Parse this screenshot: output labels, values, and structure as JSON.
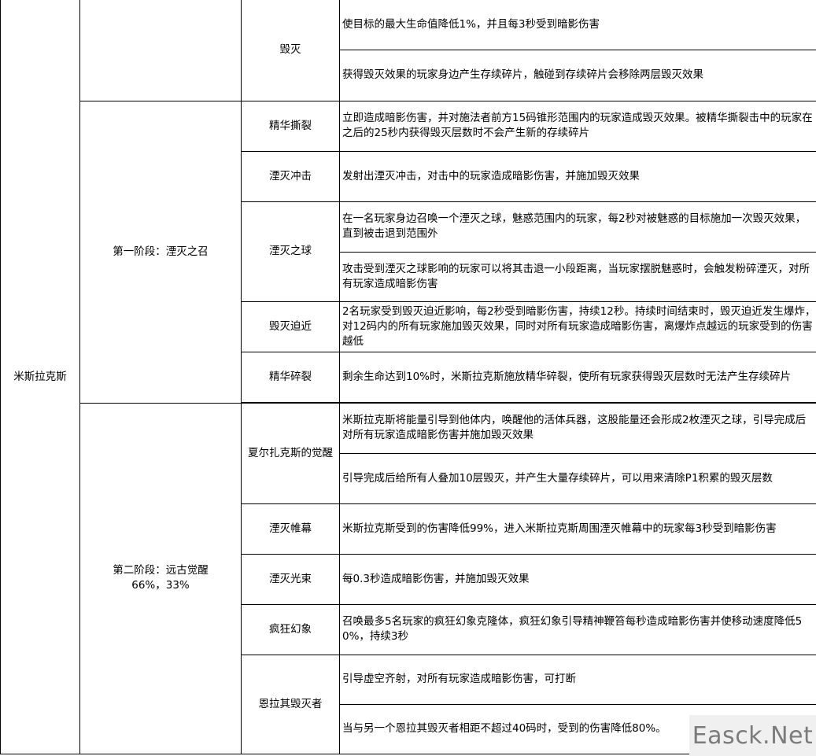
{
  "boss": "米斯拉克斯",
  "phase1": {
    "label": "第一阶段：湮灭之召"
  },
  "phase2": {
    "label": "第二阶段：远古觉醒",
    "sub": "66%，33%"
  },
  "rows": [
    {
      "ability": "毁灭",
      "lines": [
        "使目标的最大生命值降低1%，并且每3秒受到暗影伤害",
        "获得毁灭效果的玩家身边产生存续碎片，触碰到存续碎片会移除两层毁灭效果"
      ]
    },
    {
      "ability": "精华撕裂",
      "lines": [
        "立即造成暗影伤害，并对施法者前方15码锥形范围内的玩家造成毁灭效果。被精华撕裂击中的玩家在之后的25秒内获得毁灭层数时不会产生新的存续碎片"
      ]
    },
    {
      "ability": "湮灭冲击",
      "lines": [
        "发射出湮灭冲击，对击中的玩家造成暗影伤害，并施加毁灭效果"
      ]
    },
    {
      "ability": "湮灭之球",
      "lines": [
        "在一名玩家身边召唤一个湮灭之球，魅惑范围内的玩家，每2秒对被魅惑的目标施加一次毁灭效果，直到被击退到范围外",
        "攻击受到湮灭之球影响的玩家可以将其击退一小段距离，当玩家摆脱魅惑时，会触发粉碎湮灭，对所有玩家造成暗影伤害"
      ]
    },
    {
      "ability": "毁灭迫近",
      "lines": [
        "2名玩家受到毁灭迫近影响，每2秒受到暗影伤害，持续12秒。持续时间结束时，毁灭迫近发生爆炸，对12码内的所有玩家施加毁灭效果，同时对所有玩家造成暗影伤害，离爆炸点越远的玩家受到的伤害越低"
      ]
    },
    {
      "ability": "精华碎裂",
      "lines": [
        "剩余生命达到10%时，米斯拉克斯施放精华碎裂，使所有玩家获得毁灭层数时无法产生存续碎片"
      ]
    },
    {
      "ability": "夏尔扎克斯的觉醒",
      "lines": [
        "米斯拉克斯将能量引导到他体内，唤醒他的活体兵器，这股能量还会形成2枚湮灭之球，引导完成后对所有玩家造成暗影伤害并施加毁灭效果",
        "引导完成后给所有人叠加10层毁灭，并产生大量存续碎片，可以用来清除P1积累的毁灭层数"
      ]
    },
    {
      "ability": "湮灭帷幕",
      "lines": [
        "米斯拉克斯受到的伤害降低99%，进入米斯拉克斯周围湮灭帷幕中的玩家每3秒受到暗影伤害"
      ]
    },
    {
      "ability": "湮灭光束",
      "lines": [
        "每0.3秒造成暗影伤害，并施加毁灭效果"
      ]
    },
    {
      "ability": "疯狂幻象",
      "lines": [
        "召唤最多5名玩家的疯狂幻象克隆体，疯狂幻象引导精神鞭笞每秒造成暗影伤害并使移动速度降低50%，持续3秒"
      ]
    },
    {
      "ability": "恩拉其毁灭者",
      "lines": [
        "引导虚空齐射，对所有玩家造成暗影伤害，可打断",
        "当与另一个恩拉其毁灭者相距不超过40码时，受到的伤害降低80%。"
      ]
    }
  ],
  "watermark": "Easck.Net"
}
